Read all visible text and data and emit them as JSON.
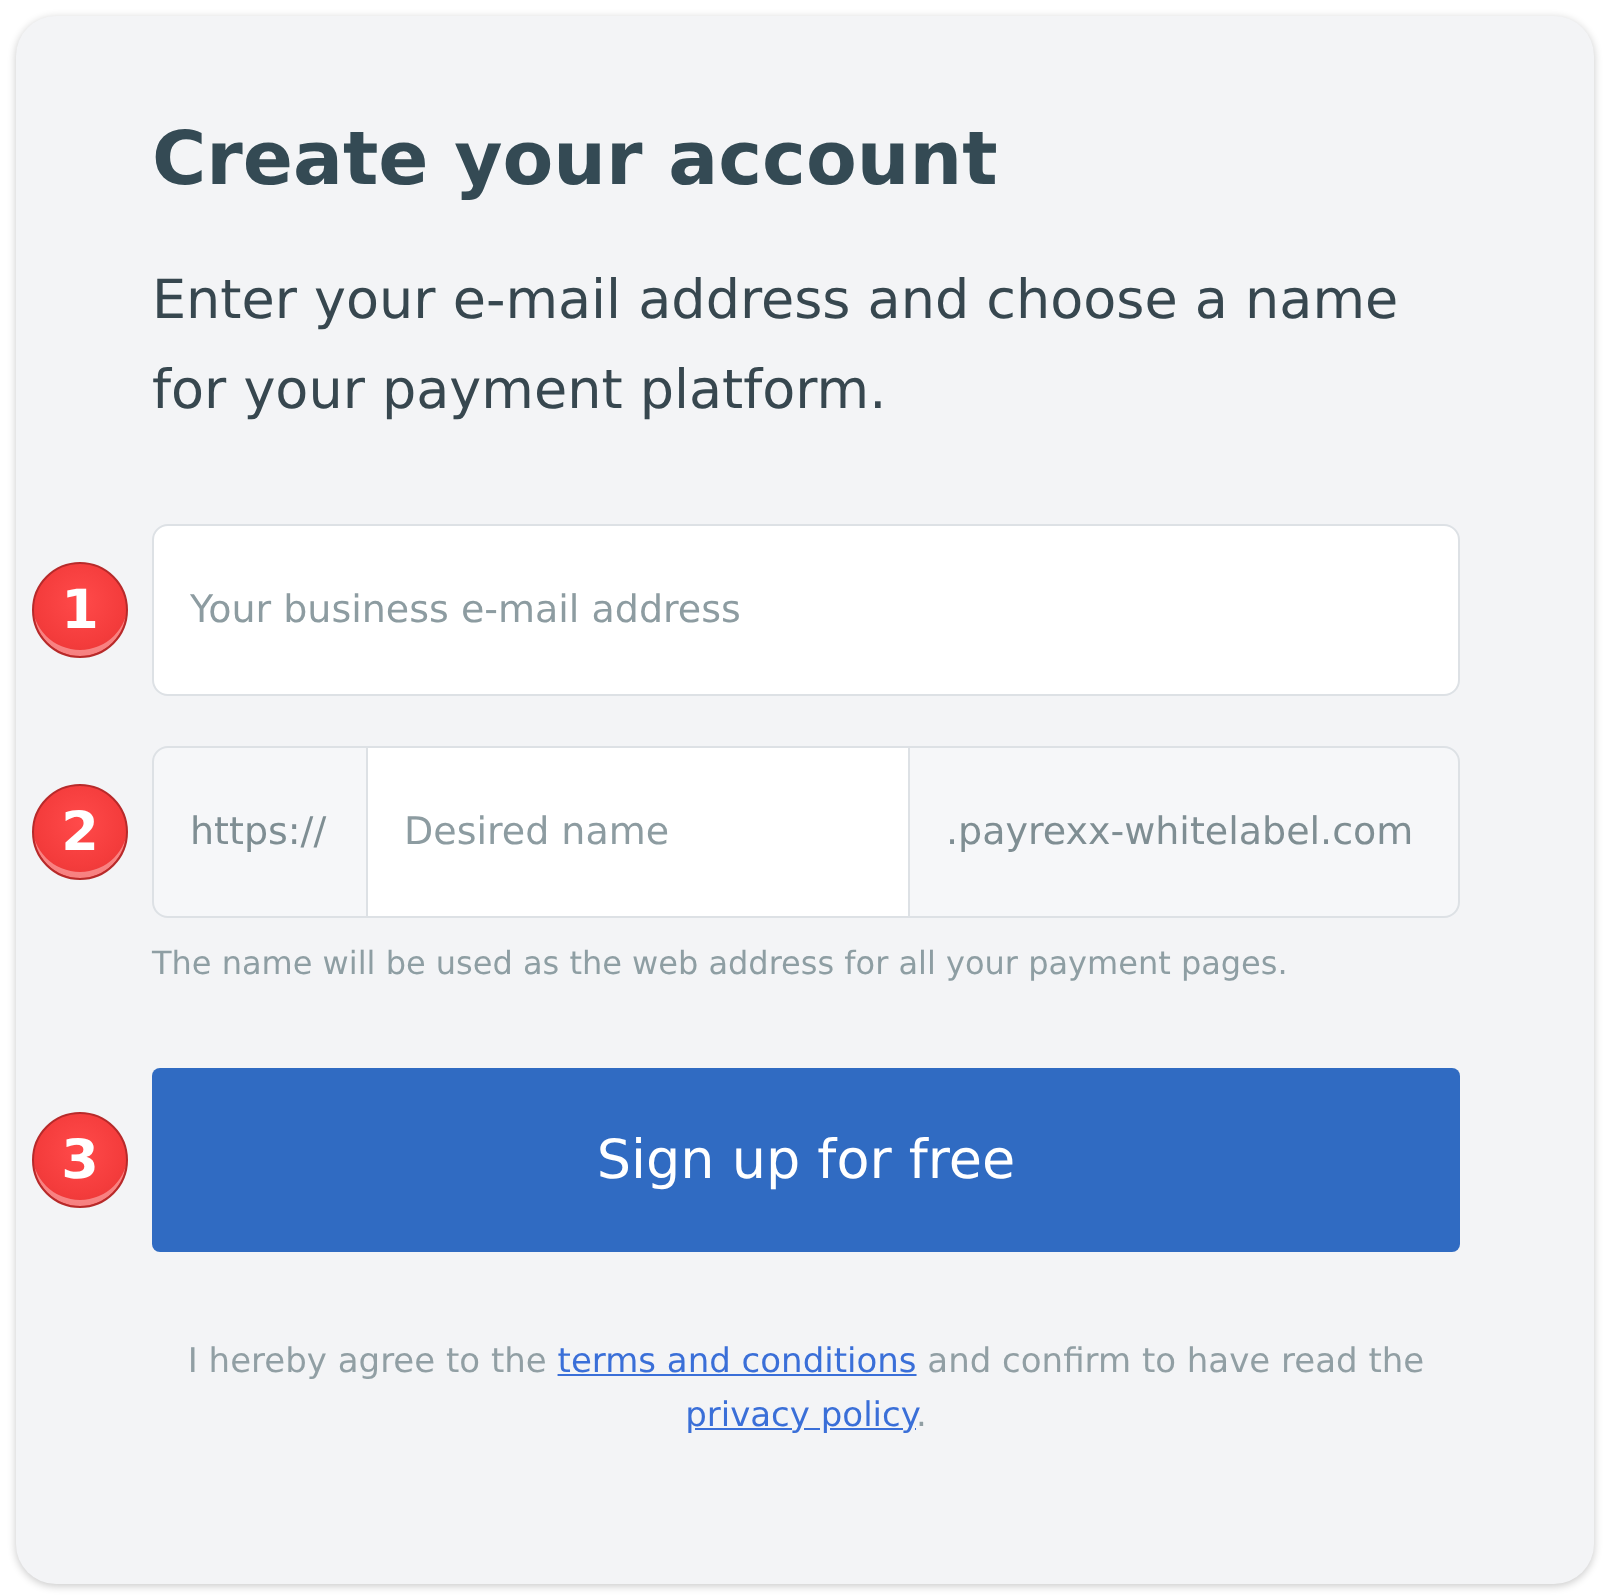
{
  "title": "Create your account",
  "subtitle": "Enter your e-mail address and choose a name for your payment platform.",
  "steps": [
    {
      "marker": "1",
      "kind": "email",
      "placeholder": "Your business e-mail address"
    },
    {
      "marker": "2",
      "kind": "domain",
      "prefix": "https://",
      "placeholder": "Desired name",
      "suffix": ".payrexx-whitelabel.com",
      "hint": "The name will be used as the web address for all your payment pages."
    },
    {
      "marker": "3",
      "kind": "button",
      "label": "Sign up for free"
    }
  ],
  "consent": [
    {
      "kind": "text",
      "text": "I hereby agree to the "
    },
    {
      "kind": "link",
      "text": "terms and conditions"
    },
    {
      "kind": "text",
      "text": " and confirm to have read the "
    },
    {
      "kind": "link",
      "text": "privacy policy"
    },
    {
      "kind": "text",
      "text": "."
    }
  ]
}
